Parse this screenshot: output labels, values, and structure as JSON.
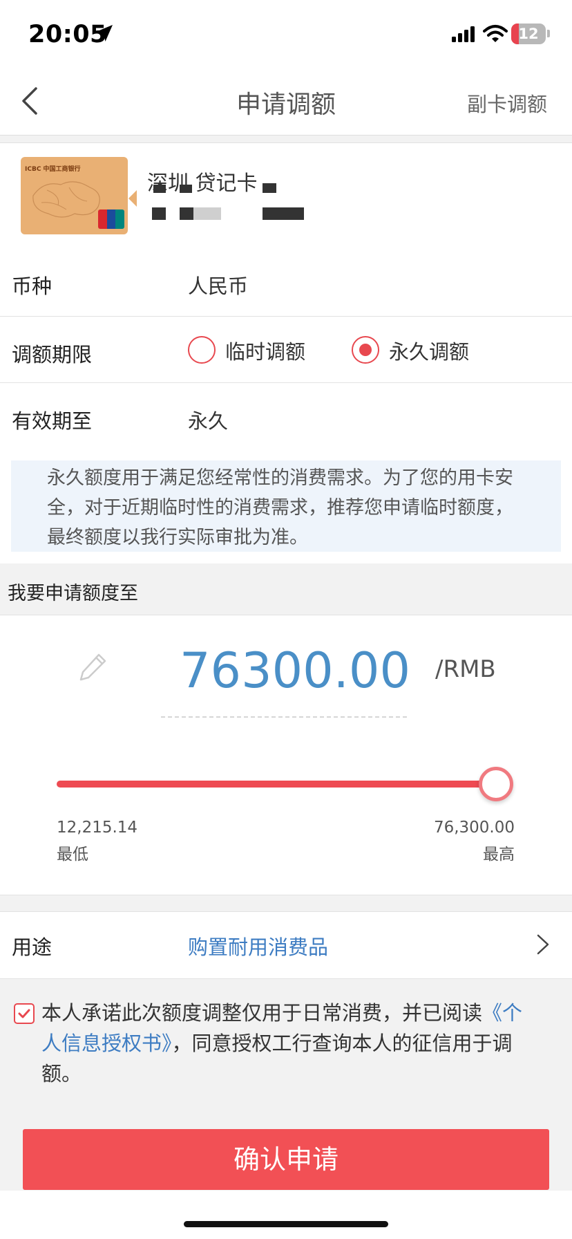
{
  "status_bar": {
    "time": "20:05",
    "battery": "12"
  },
  "nav": {
    "title": "申请调额",
    "right_action": "副卡调额"
  },
  "card": {
    "bank_label": "ICBC 中国工商银行",
    "name": "深圳  贷记卡"
  },
  "currency": {
    "label": "币种",
    "value": "人民币"
  },
  "term": {
    "label": "调额期限",
    "options": [
      {
        "label": "临时调额",
        "selected": false
      },
      {
        "label": "永久调额",
        "selected": true
      }
    ]
  },
  "valid_until": {
    "label": "有效期至",
    "value": "永久"
  },
  "notice": "永久额度用于满足您经常性的消费需求。为了您的用卡安全，对于近期临时性的消费需求，推荐您申请临时额度，最终额度以我行实际审批为准。",
  "apply": {
    "section_title": "我要申请额度至",
    "amount": "76300.00",
    "unit": "/RMB",
    "slider": {
      "min": 12215.14,
      "max": 76300.0,
      "value": 76300.0
    },
    "min_value": "12,215.14",
    "min_label": "最低",
    "max_value": "76,300.00",
    "max_label": "最高"
  },
  "purpose": {
    "label": "用途",
    "value": "购置耐用消费品"
  },
  "consent": {
    "checked": true,
    "text_before": "本人承诺此次额度调整仅用于日常消费，并已阅读",
    "link": "《个人信息授权书》",
    "text_after": "，同意授权工行查询本人的征信用于调额。"
  },
  "confirm_button": "确认申请",
  "colors": {
    "accent": "#f25055",
    "link": "#3d7cc2",
    "amount": "#4a8fc7"
  }
}
